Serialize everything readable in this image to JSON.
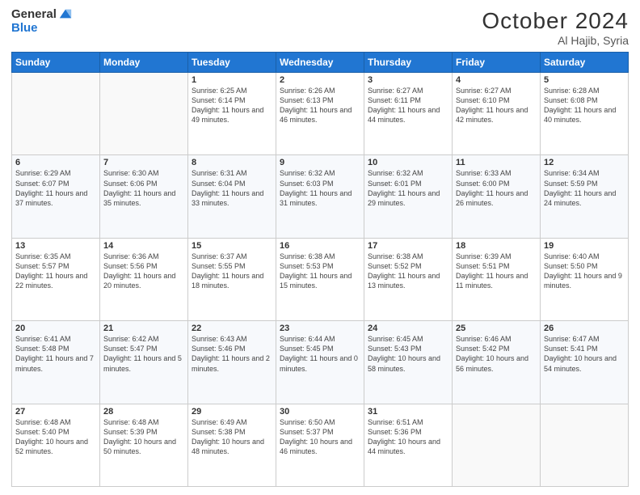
{
  "logo": {
    "general": "General",
    "blue": "Blue"
  },
  "header": {
    "month": "October 2024",
    "location": "Al Hajib, Syria"
  },
  "weekdays": [
    "Sunday",
    "Monday",
    "Tuesday",
    "Wednesday",
    "Thursday",
    "Friday",
    "Saturday"
  ],
  "weeks": [
    [
      {
        "day": "",
        "info": ""
      },
      {
        "day": "",
        "info": ""
      },
      {
        "day": "1",
        "info": "Sunrise: 6:25 AM\nSunset: 6:14 PM\nDaylight: 11 hours and 49 minutes."
      },
      {
        "day": "2",
        "info": "Sunrise: 6:26 AM\nSunset: 6:13 PM\nDaylight: 11 hours and 46 minutes."
      },
      {
        "day": "3",
        "info": "Sunrise: 6:27 AM\nSunset: 6:11 PM\nDaylight: 11 hours and 44 minutes."
      },
      {
        "day": "4",
        "info": "Sunrise: 6:27 AM\nSunset: 6:10 PM\nDaylight: 11 hours and 42 minutes."
      },
      {
        "day": "5",
        "info": "Sunrise: 6:28 AM\nSunset: 6:08 PM\nDaylight: 11 hours and 40 minutes."
      }
    ],
    [
      {
        "day": "6",
        "info": "Sunrise: 6:29 AM\nSunset: 6:07 PM\nDaylight: 11 hours and 37 minutes."
      },
      {
        "day": "7",
        "info": "Sunrise: 6:30 AM\nSunset: 6:06 PM\nDaylight: 11 hours and 35 minutes."
      },
      {
        "day": "8",
        "info": "Sunrise: 6:31 AM\nSunset: 6:04 PM\nDaylight: 11 hours and 33 minutes."
      },
      {
        "day": "9",
        "info": "Sunrise: 6:32 AM\nSunset: 6:03 PM\nDaylight: 11 hours and 31 minutes."
      },
      {
        "day": "10",
        "info": "Sunrise: 6:32 AM\nSunset: 6:01 PM\nDaylight: 11 hours and 29 minutes."
      },
      {
        "day": "11",
        "info": "Sunrise: 6:33 AM\nSunset: 6:00 PM\nDaylight: 11 hours and 26 minutes."
      },
      {
        "day": "12",
        "info": "Sunrise: 6:34 AM\nSunset: 5:59 PM\nDaylight: 11 hours and 24 minutes."
      }
    ],
    [
      {
        "day": "13",
        "info": "Sunrise: 6:35 AM\nSunset: 5:57 PM\nDaylight: 11 hours and 22 minutes."
      },
      {
        "day": "14",
        "info": "Sunrise: 6:36 AM\nSunset: 5:56 PM\nDaylight: 11 hours and 20 minutes."
      },
      {
        "day": "15",
        "info": "Sunrise: 6:37 AM\nSunset: 5:55 PM\nDaylight: 11 hours and 18 minutes."
      },
      {
        "day": "16",
        "info": "Sunrise: 6:38 AM\nSunset: 5:53 PM\nDaylight: 11 hours and 15 minutes."
      },
      {
        "day": "17",
        "info": "Sunrise: 6:38 AM\nSunset: 5:52 PM\nDaylight: 11 hours and 13 minutes."
      },
      {
        "day": "18",
        "info": "Sunrise: 6:39 AM\nSunset: 5:51 PM\nDaylight: 11 hours and 11 minutes."
      },
      {
        "day": "19",
        "info": "Sunrise: 6:40 AM\nSunset: 5:50 PM\nDaylight: 11 hours and 9 minutes."
      }
    ],
    [
      {
        "day": "20",
        "info": "Sunrise: 6:41 AM\nSunset: 5:48 PM\nDaylight: 11 hours and 7 minutes."
      },
      {
        "day": "21",
        "info": "Sunrise: 6:42 AM\nSunset: 5:47 PM\nDaylight: 11 hours and 5 minutes."
      },
      {
        "day": "22",
        "info": "Sunrise: 6:43 AM\nSunset: 5:46 PM\nDaylight: 11 hours and 2 minutes."
      },
      {
        "day": "23",
        "info": "Sunrise: 6:44 AM\nSunset: 5:45 PM\nDaylight: 11 hours and 0 minutes."
      },
      {
        "day": "24",
        "info": "Sunrise: 6:45 AM\nSunset: 5:43 PM\nDaylight: 10 hours and 58 minutes."
      },
      {
        "day": "25",
        "info": "Sunrise: 6:46 AM\nSunset: 5:42 PM\nDaylight: 10 hours and 56 minutes."
      },
      {
        "day": "26",
        "info": "Sunrise: 6:47 AM\nSunset: 5:41 PM\nDaylight: 10 hours and 54 minutes."
      }
    ],
    [
      {
        "day": "27",
        "info": "Sunrise: 6:48 AM\nSunset: 5:40 PM\nDaylight: 10 hours and 52 minutes."
      },
      {
        "day": "28",
        "info": "Sunrise: 6:48 AM\nSunset: 5:39 PM\nDaylight: 10 hours and 50 minutes."
      },
      {
        "day": "29",
        "info": "Sunrise: 6:49 AM\nSunset: 5:38 PM\nDaylight: 10 hours and 48 minutes."
      },
      {
        "day": "30",
        "info": "Sunrise: 6:50 AM\nSunset: 5:37 PM\nDaylight: 10 hours and 46 minutes."
      },
      {
        "day": "31",
        "info": "Sunrise: 6:51 AM\nSunset: 5:36 PM\nDaylight: 10 hours and 44 minutes."
      },
      {
        "day": "",
        "info": ""
      },
      {
        "day": "",
        "info": ""
      }
    ]
  ]
}
